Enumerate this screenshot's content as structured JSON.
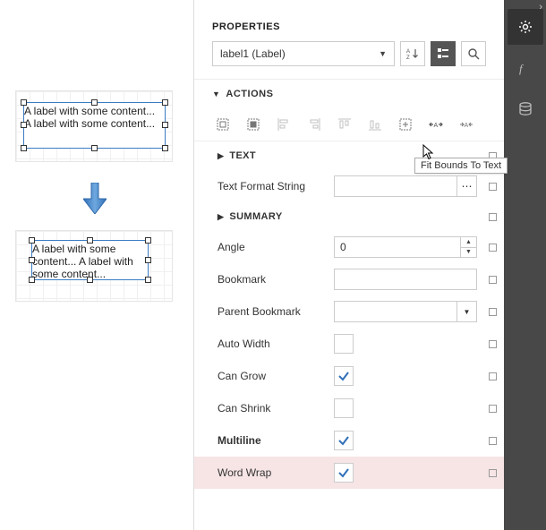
{
  "canvas": {
    "label_before": "A label with some content... A label with some content...",
    "label_after": "A label with some content... A label with some content..."
  },
  "panel": {
    "title": "PROPERTIES",
    "selected_element": "label1 (Label)"
  },
  "sections": {
    "actions": "ACTIONS",
    "text": "TEXT",
    "summary": "SUMMARY"
  },
  "tooltip": "Fit Bounds To Text",
  "props": {
    "text_format_string": {
      "label": "Text Format String",
      "value": ""
    },
    "angle": {
      "label": "Angle",
      "value": "0"
    },
    "bookmark": {
      "label": "Bookmark",
      "value": ""
    },
    "parent_bookmark": {
      "label": "Parent Bookmark",
      "value": ""
    },
    "auto_width": {
      "label": "Auto Width",
      "checked": false
    },
    "can_grow": {
      "label": "Can Grow",
      "checked": true
    },
    "can_shrink": {
      "label": "Can Shrink",
      "checked": false
    },
    "multiline": {
      "label": "Multiline",
      "checked": true
    },
    "word_wrap": {
      "label": "Word Wrap",
      "checked": true
    }
  },
  "icons": {
    "sort_az": "sort-alpha-icon",
    "categorize": "categorize-icon",
    "search": "search-icon",
    "gear": "gear-icon",
    "fx": "function-icon",
    "db": "database-icon"
  }
}
